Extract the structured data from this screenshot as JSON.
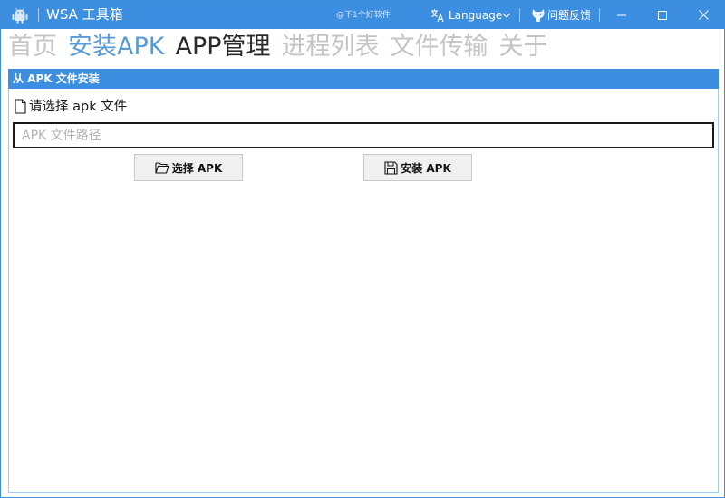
{
  "window": {
    "title": "WSA 工具箱",
    "slogan": "@下1个好软件",
    "language_label": "Language",
    "feedback_label": "问题反馈"
  },
  "tabs": [
    {
      "label": "首页",
      "state": "inactive"
    },
    {
      "label": "安装APK",
      "state": "hover"
    },
    {
      "label": "APP管理",
      "state": "active"
    },
    {
      "label": "进程列表",
      "state": "inactive"
    },
    {
      "label": "文件传输",
      "state": "inactive"
    },
    {
      "label": "关于",
      "state": "inactive"
    }
  ],
  "install": {
    "group_title": "从 APK 文件安装",
    "choose_label": "请选择 apk 文件",
    "path_value": "",
    "path_placeholder": "APK 文件路径",
    "select_button": "选择 APK",
    "install_button": "安装 APK"
  },
  "icons": {
    "app": "android-icon",
    "language": "translate-icon",
    "language_menu": "chevron-down-icon",
    "feedback": "github-icon",
    "file": "file-icon",
    "select": "folder-open-icon",
    "install": "save-icon"
  },
  "colors": {
    "accent": "#3c8ee0",
    "tab_hover": "#5a9bd6",
    "tab_active": "#2a2a2a",
    "tab_inactive": "#c4c4c4"
  }
}
